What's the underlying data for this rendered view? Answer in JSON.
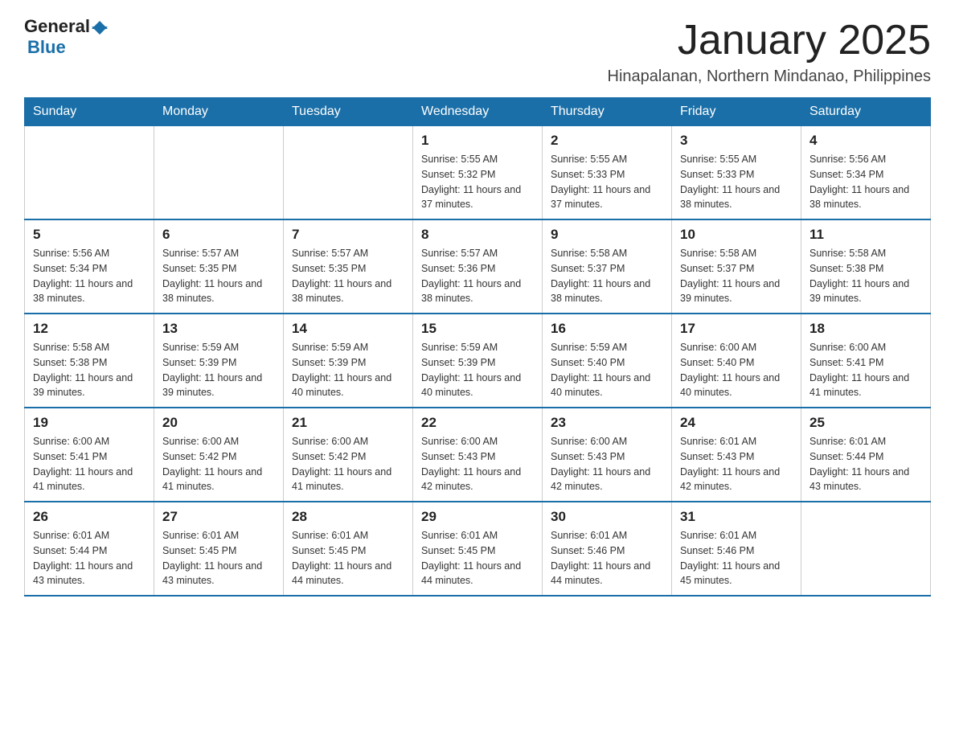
{
  "logo": {
    "text_general": "General",
    "text_blue": "Blue"
  },
  "title": "January 2025",
  "subtitle": "Hinapalanan, Northern Mindanao, Philippines",
  "days_of_week": [
    "Sunday",
    "Monday",
    "Tuesday",
    "Wednesday",
    "Thursday",
    "Friday",
    "Saturday"
  ],
  "weeks": [
    [
      {
        "day": "",
        "info": ""
      },
      {
        "day": "",
        "info": ""
      },
      {
        "day": "",
        "info": ""
      },
      {
        "day": "1",
        "info": "Sunrise: 5:55 AM\nSunset: 5:32 PM\nDaylight: 11 hours and 37 minutes."
      },
      {
        "day": "2",
        "info": "Sunrise: 5:55 AM\nSunset: 5:33 PM\nDaylight: 11 hours and 37 minutes."
      },
      {
        "day": "3",
        "info": "Sunrise: 5:55 AM\nSunset: 5:33 PM\nDaylight: 11 hours and 38 minutes."
      },
      {
        "day": "4",
        "info": "Sunrise: 5:56 AM\nSunset: 5:34 PM\nDaylight: 11 hours and 38 minutes."
      }
    ],
    [
      {
        "day": "5",
        "info": "Sunrise: 5:56 AM\nSunset: 5:34 PM\nDaylight: 11 hours and 38 minutes."
      },
      {
        "day": "6",
        "info": "Sunrise: 5:57 AM\nSunset: 5:35 PM\nDaylight: 11 hours and 38 minutes."
      },
      {
        "day": "7",
        "info": "Sunrise: 5:57 AM\nSunset: 5:35 PM\nDaylight: 11 hours and 38 minutes."
      },
      {
        "day": "8",
        "info": "Sunrise: 5:57 AM\nSunset: 5:36 PM\nDaylight: 11 hours and 38 minutes."
      },
      {
        "day": "9",
        "info": "Sunrise: 5:58 AM\nSunset: 5:37 PM\nDaylight: 11 hours and 38 minutes."
      },
      {
        "day": "10",
        "info": "Sunrise: 5:58 AM\nSunset: 5:37 PM\nDaylight: 11 hours and 39 minutes."
      },
      {
        "day": "11",
        "info": "Sunrise: 5:58 AM\nSunset: 5:38 PM\nDaylight: 11 hours and 39 minutes."
      }
    ],
    [
      {
        "day": "12",
        "info": "Sunrise: 5:58 AM\nSunset: 5:38 PM\nDaylight: 11 hours and 39 minutes."
      },
      {
        "day": "13",
        "info": "Sunrise: 5:59 AM\nSunset: 5:39 PM\nDaylight: 11 hours and 39 minutes."
      },
      {
        "day": "14",
        "info": "Sunrise: 5:59 AM\nSunset: 5:39 PM\nDaylight: 11 hours and 40 minutes."
      },
      {
        "day": "15",
        "info": "Sunrise: 5:59 AM\nSunset: 5:39 PM\nDaylight: 11 hours and 40 minutes."
      },
      {
        "day": "16",
        "info": "Sunrise: 5:59 AM\nSunset: 5:40 PM\nDaylight: 11 hours and 40 minutes."
      },
      {
        "day": "17",
        "info": "Sunrise: 6:00 AM\nSunset: 5:40 PM\nDaylight: 11 hours and 40 minutes."
      },
      {
        "day": "18",
        "info": "Sunrise: 6:00 AM\nSunset: 5:41 PM\nDaylight: 11 hours and 41 minutes."
      }
    ],
    [
      {
        "day": "19",
        "info": "Sunrise: 6:00 AM\nSunset: 5:41 PM\nDaylight: 11 hours and 41 minutes."
      },
      {
        "day": "20",
        "info": "Sunrise: 6:00 AM\nSunset: 5:42 PM\nDaylight: 11 hours and 41 minutes."
      },
      {
        "day": "21",
        "info": "Sunrise: 6:00 AM\nSunset: 5:42 PM\nDaylight: 11 hours and 41 minutes."
      },
      {
        "day": "22",
        "info": "Sunrise: 6:00 AM\nSunset: 5:43 PM\nDaylight: 11 hours and 42 minutes."
      },
      {
        "day": "23",
        "info": "Sunrise: 6:00 AM\nSunset: 5:43 PM\nDaylight: 11 hours and 42 minutes."
      },
      {
        "day": "24",
        "info": "Sunrise: 6:01 AM\nSunset: 5:43 PM\nDaylight: 11 hours and 42 minutes."
      },
      {
        "day": "25",
        "info": "Sunrise: 6:01 AM\nSunset: 5:44 PM\nDaylight: 11 hours and 43 minutes."
      }
    ],
    [
      {
        "day": "26",
        "info": "Sunrise: 6:01 AM\nSunset: 5:44 PM\nDaylight: 11 hours and 43 minutes."
      },
      {
        "day": "27",
        "info": "Sunrise: 6:01 AM\nSunset: 5:45 PM\nDaylight: 11 hours and 43 minutes."
      },
      {
        "day": "28",
        "info": "Sunrise: 6:01 AM\nSunset: 5:45 PM\nDaylight: 11 hours and 44 minutes."
      },
      {
        "day": "29",
        "info": "Sunrise: 6:01 AM\nSunset: 5:45 PM\nDaylight: 11 hours and 44 minutes."
      },
      {
        "day": "30",
        "info": "Sunrise: 6:01 AM\nSunset: 5:46 PM\nDaylight: 11 hours and 44 minutes."
      },
      {
        "day": "31",
        "info": "Sunrise: 6:01 AM\nSunset: 5:46 PM\nDaylight: 11 hours and 45 minutes."
      },
      {
        "day": "",
        "info": ""
      }
    ]
  ]
}
